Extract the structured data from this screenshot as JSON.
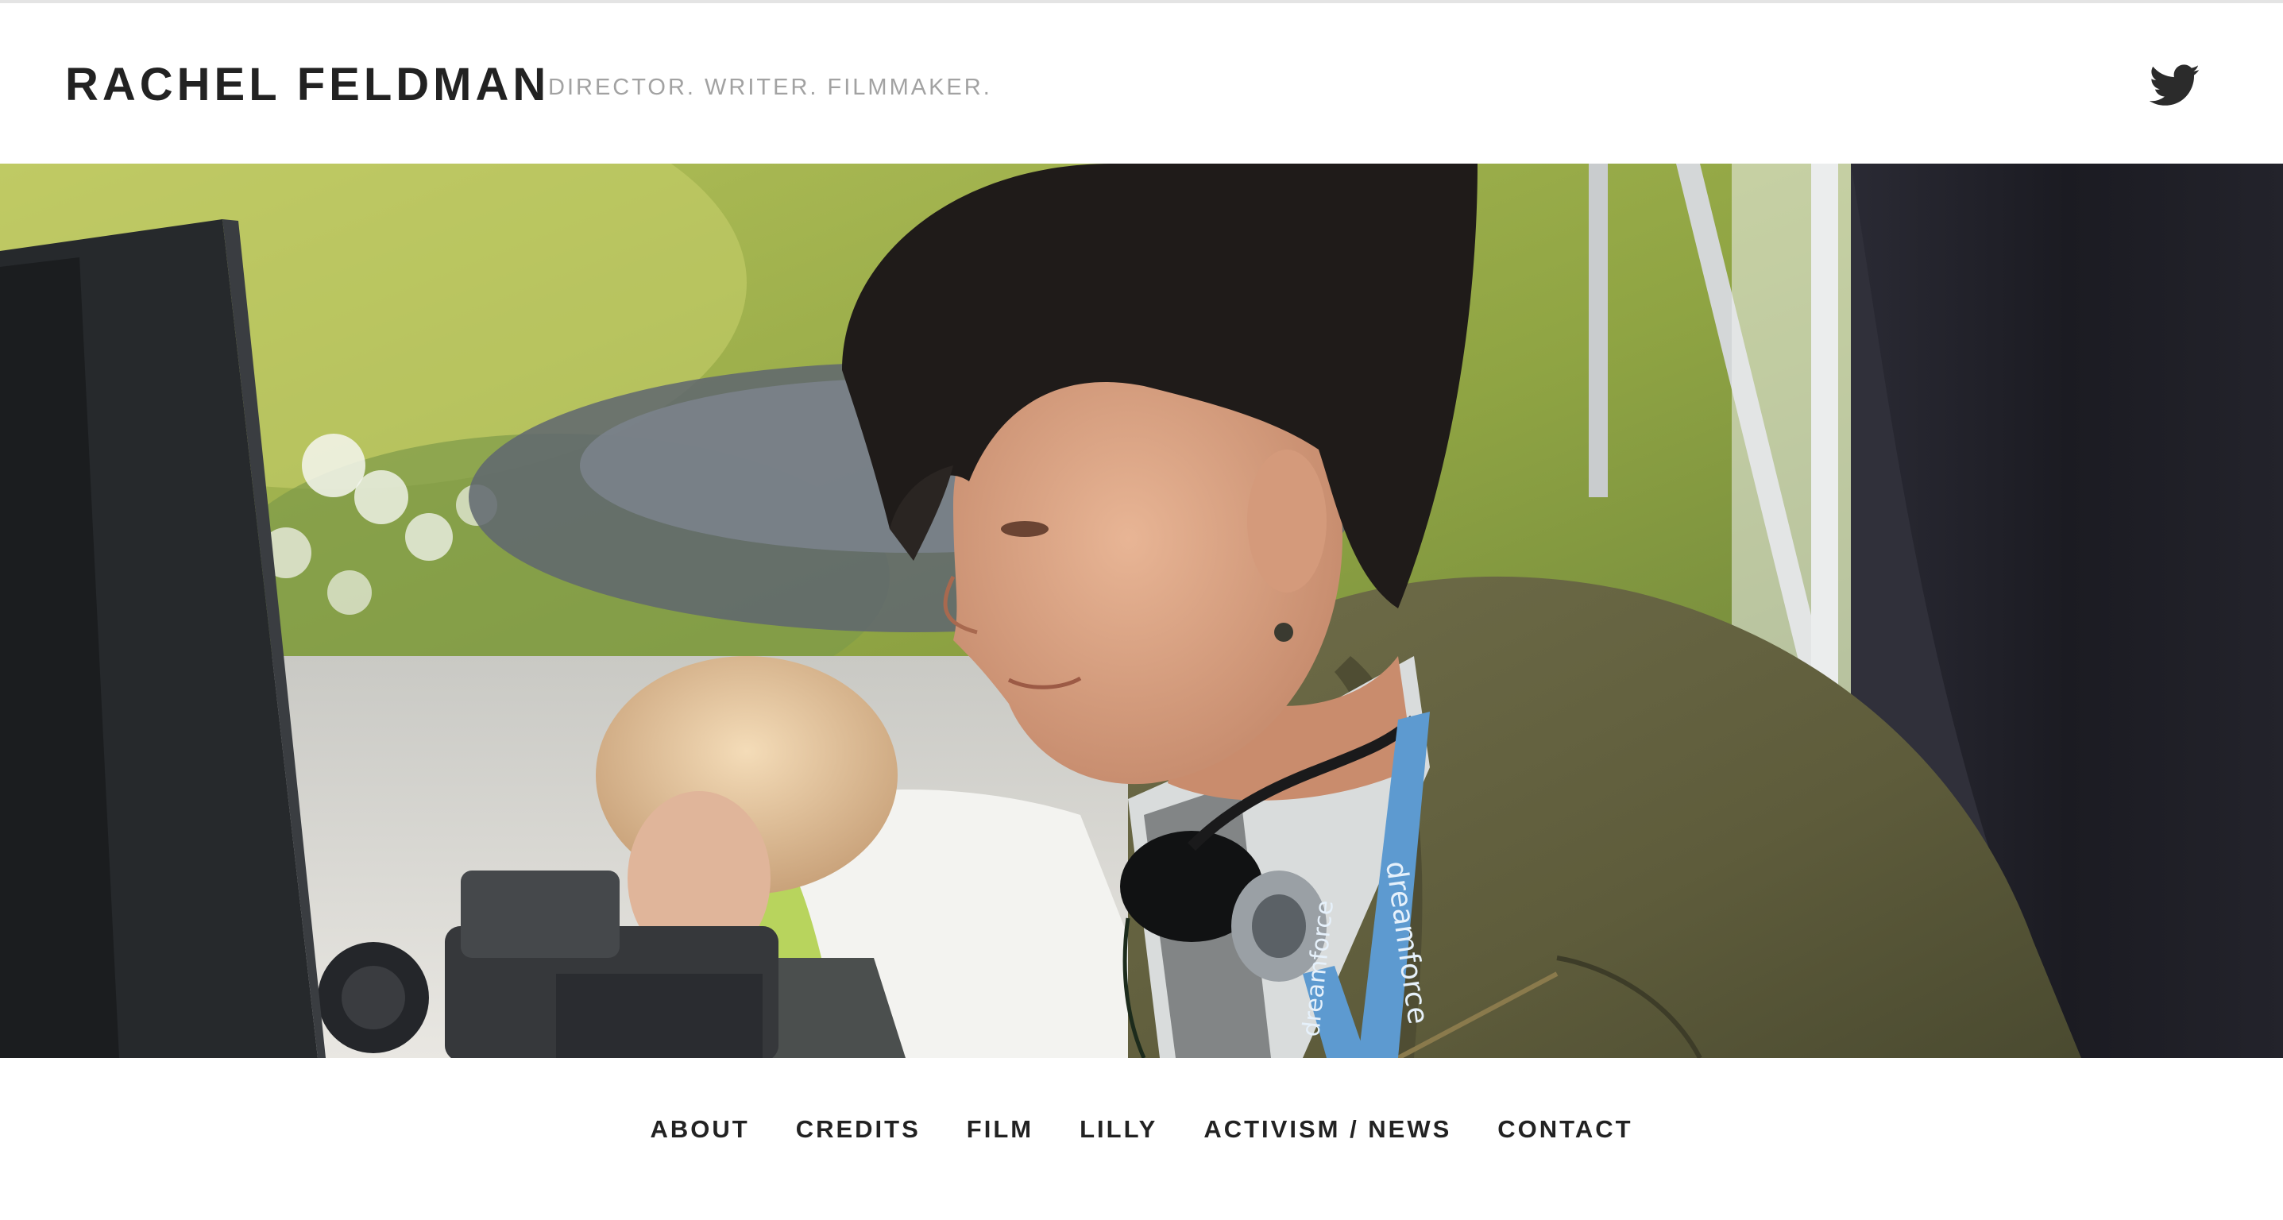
{
  "header": {
    "site_title": "RACHEL FELDMAN",
    "tagline": "DIRECTOR. WRITER. FILMMAKER.",
    "social_icon": "twitter-icon"
  },
  "hero": {
    "image_subject": "director on film set beside monitor",
    "lanyard_text": "dreamforce"
  },
  "nav": {
    "items": [
      {
        "label": "ABOUT"
      },
      {
        "label": "CREDITS"
      },
      {
        "label": "FILM"
      },
      {
        "label": "LILLY"
      },
      {
        "label": "ACTIVISM / NEWS"
      },
      {
        "label": "CONTACT"
      }
    ]
  },
  "colors": {
    "title": "#222222",
    "tagline": "#a2a2a2",
    "background": "#ffffff"
  }
}
